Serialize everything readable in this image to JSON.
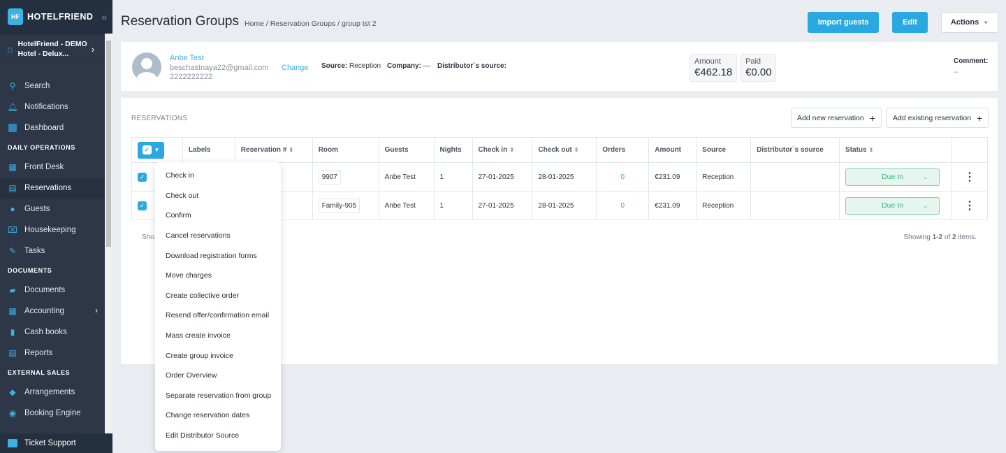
{
  "brand": {
    "name": "HOTELFRIEND",
    "logo_letters": "HF"
  },
  "hotel": {
    "line1": "HotelFriend - DEMO",
    "line2": "Hotel - Delux..."
  },
  "sidebar": {
    "top": [
      {
        "label": "Search",
        "icon": "search-icon"
      },
      {
        "label": "Notifications",
        "icon": "bell-icon"
      },
      {
        "label": "Dashboard",
        "icon": "dashboard-icon"
      }
    ],
    "sections": [
      {
        "title": "DAILY OPERATIONS",
        "items": [
          {
            "label": "Front Desk"
          },
          {
            "label": "Reservations",
            "active": true
          },
          {
            "label": "Guests"
          },
          {
            "label": "Housekeeping"
          },
          {
            "label": "Tasks"
          }
        ]
      },
      {
        "title": "DOCUMENTS",
        "items": [
          {
            "label": "Documents"
          },
          {
            "label": "Accounting",
            "has_submenu": true
          },
          {
            "label": "Cash books"
          },
          {
            "label": "Reports"
          }
        ]
      },
      {
        "title": "EXTERNAL SALES",
        "items": [
          {
            "label": "Arrangements"
          },
          {
            "label": "Booking Engine"
          }
        ]
      }
    ],
    "ticket": "Ticket Support"
  },
  "header": {
    "title": "Reservation Groups",
    "breadcrumb": [
      "Home",
      "Reservation Groups",
      "group tst 2"
    ],
    "import_label": "Import guests",
    "edit_label": "Edit",
    "actions_label": "Actions"
  },
  "guest": {
    "name": "Anbe Test",
    "email": "beschastnaya22@gmail.com",
    "phone": "2222222222",
    "change_label": "Change",
    "source_label": "Source:",
    "source": "Reception",
    "company_label": "Company:",
    "company": "—",
    "distributor_label": "Distributor`s source:",
    "amount_label": "Amount",
    "amount": "€462.18",
    "paid_label": "Paid",
    "paid": "€0.00",
    "comment_label": "Comment:",
    "comment": "–"
  },
  "reservations": {
    "title": "RESERVATIONS",
    "add_new": "Add new reservation",
    "add_existing": "Add existing reservation",
    "columns": [
      "Labels",
      "Reservation #",
      "Room",
      "Guests",
      "Nights",
      "Check in",
      "Check out",
      "Orders",
      "Amount",
      "Source",
      "Distributor`s source",
      "Status"
    ],
    "rows": [
      {
        "room": "9907",
        "guests": "Anbe Test",
        "nights": "1",
        "checkin": "27-01-2025",
        "checkout": "28-01-2025",
        "orders": "0",
        "amount": "€231.09",
        "source": "Reception",
        "distributor": "",
        "status": "Due In",
        "checked": true
      },
      {
        "room": "Family-905",
        "guests": "Anbe Test",
        "nights": "1",
        "checkin": "27-01-2025",
        "checkout": "28-01-2025",
        "orders": "0",
        "amount": "€231.09",
        "source": "Reception",
        "distributor": "",
        "status": "Due In",
        "checked": true
      }
    ],
    "footer_left": "Sho",
    "showing": {
      "prefix": "Showing ",
      "range": "1-2",
      "of": " of ",
      "total": "2",
      "suffix": " items."
    }
  },
  "bulk_menu": [
    "Check in",
    "Check out",
    "Confirm",
    "Cancel reservations",
    "Download registration forms",
    "Move charges",
    "Create collective order",
    "Resend offer/confirmation email",
    "Mass create invoice",
    "Create group invoice",
    "Order Overview",
    "Separate reservation from group",
    "Change reservation dates",
    "Edit Distributor Source"
  ],
  "colors": {
    "accent": "#2aa9e0",
    "sidebar": "#2d3748",
    "status_bg": "#e6f5ee",
    "status_text": "#3cb27f"
  }
}
